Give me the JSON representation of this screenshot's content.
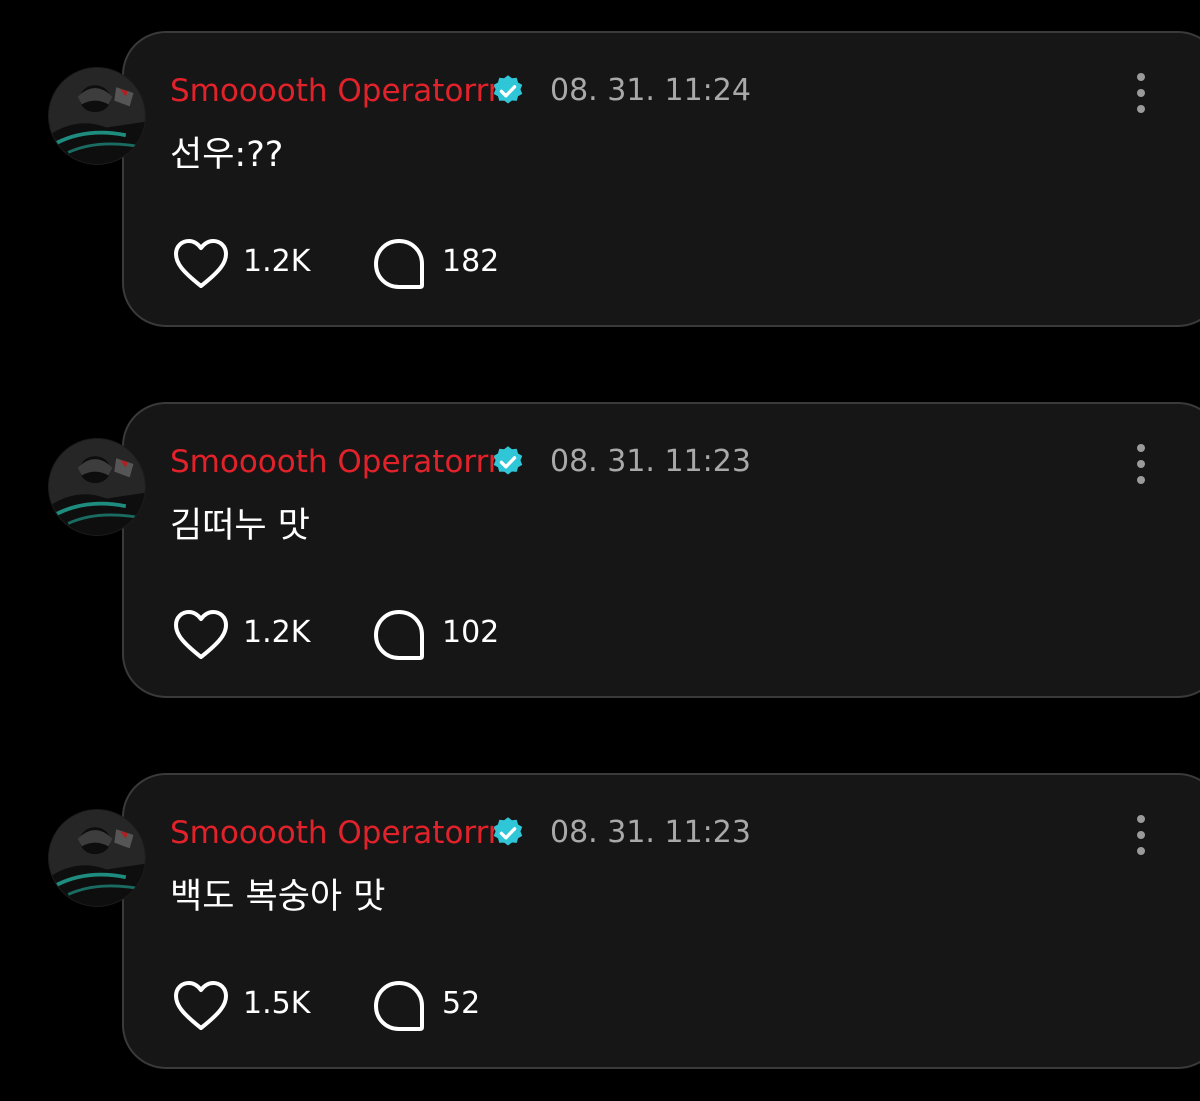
{
  "colors": {
    "background": "#000000",
    "card": "#161616",
    "card_border": "#3a3a3a",
    "username": "#e2222a",
    "timestamp": "#a9a9a9",
    "verified_badge": "#2fc6d8"
  },
  "icons": {
    "like": "heart-outline-icon",
    "comment": "speech-bubble-outline-icon",
    "verified": "verified-badge-icon",
    "more": "vertical-ellipsis-icon"
  },
  "comments": [
    {
      "username": "Smooooth Operatorrrr",
      "timestamp": "08. 31. 11:24",
      "text": "선우:??",
      "likes": "1.2K",
      "replies": "182"
    },
    {
      "username": "Smooooth Operatorrrr",
      "timestamp": "08. 31. 11:23",
      "text": "김떠누 맛",
      "likes": "1.2K",
      "replies": "102"
    },
    {
      "username": "Smooooth Operatorrrr",
      "timestamp": "08. 31. 11:23",
      "text": "백도 복숭아 맛",
      "likes": "1.5K",
      "replies": "52"
    }
  ]
}
